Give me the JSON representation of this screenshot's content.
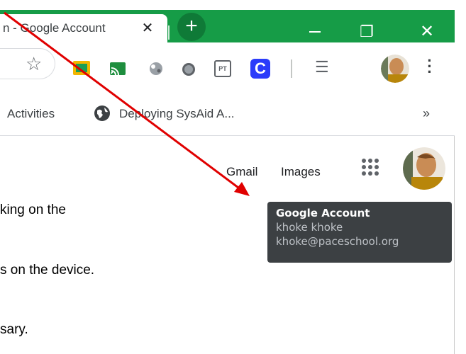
{
  "browser": {
    "tab": {
      "title": "n - Google Account",
      "close_glyph": "✕"
    },
    "new_tab_glyph": "+",
    "window_controls": {
      "restore_glyph": "❐",
      "close_glyph": "✕"
    },
    "toolbar": {
      "star_glyph": "☆",
      "pt_extension_label": "PT",
      "c_extension_label": "C",
      "media_glyph": "☰",
      "menu_glyph": "⋮"
    },
    "bookmarks": {
      "activities_label": "Activities",
      "sysaid_label": "Deploying SysAid A...",
      "overflow_glyph": "»"
    }
  },
  "google_bar": {
    "gmail_label": "Gmail",
    "images_label": "Images"
  },
  "account_tooltip": {
    "title": "Google Account",
    "name": "khoke khoke",
    "email": "khoke@paceschool.org"
  },
  "document": {
    "line_1": "king on the",
    "line_2": "s on the device.",
    "line_3": "sary."
  },
  "colors": {
    "titlebar": "#169c47",
    "tooltip_bg": "#3c4043",
    "annotation_arrow": "#e00000"
  }
}
